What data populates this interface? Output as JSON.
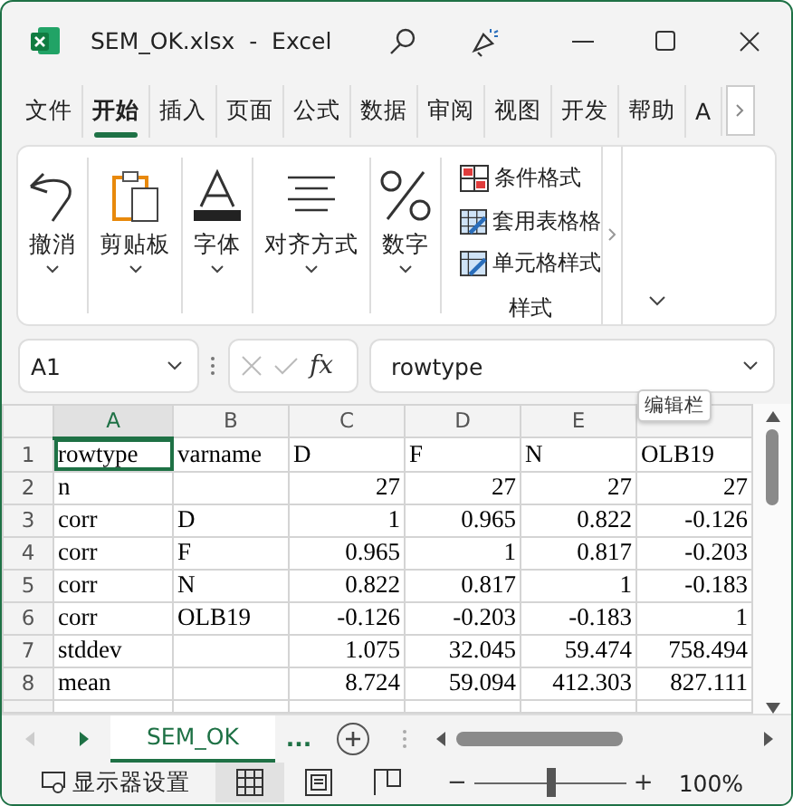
{
  "window": {
    "title": "SEM_OK.xlsx  -  Excel"
  },
  "ribbon_tabs": [
    {
      "label": "文件",
      "selected": false
    },
    {
      "label": "开始",
      "selected": true
    },
    {
      "label": "插入",
      "selected": false
    },
    {
      "label": "页面",
      "selected": false
    },
    {
      "label": "公式",
      "selected": false
    },
    {
      "label": "数据",
      "selected": false
    },
    {
      "label": "审阅",
      "selected": false
    },
    {
      "label": "视图",
      "selected": false
    },
    {
      "label": "开发",
      "selected": false
    },
    {
      "label": "帮助",
      "selected": false
    },
    {
      "label": "A",
      "selected": false
    }
  ],
  "ribbon_groups": [
    {
      "label": "撤消",
      "kind": "undo"
    },
    {
      "label": "剪贴板",
      "kind": "clipboard"
    },
    {
      "label": "字体",
      "kind": "font"
    },
    {
      "label": "对齐方式",
      "kind": "align"
    },
    {
      "label": "数字",
      "kind": "number"
    }
  ],
  "styles_group": {
    "items": [
      {
        "label": "条件格式",
        "kind": "conditional"
      },
      {
        "label": "套用表格格",
        "kind": "table"
      },
      {
        "label": "单元格样式",
        "kind": "cell"
      }
    ],
    "label": "样式"
  },
  "formula_bar": {
    "name_box": "A1",
    "function_symbol": "fx",
    "value": "rowtype",
    "tooltip": "编辑栏"
  },
  "sheet": {
    "columns": [
      "A",
      "B",
      "C",
      "D",
      "E"
    ],
    "rows": [
      {
        "number": "1",
        "cells": [
          "rowtype",
          "varname",
          "D",
          "F",
          "N",
          "OLB19"
        ]
      },
      {
        "number": "2",
        "cells": [
          "n",
          "",
          "27",
          "27",
          "27",
          "27"
        ]
      },
      {
        "number": "3",
        "cells": [
          "corr",
          "D",
          "1",
          "0.965",
          "0.822",
          "-0.126"
        ]
      },
      {
        "number": "4",
        "cells": [
          "corr",
          "F",
          "0.965",
          "1",
          "0.817",
          "-0.203"
        ]
      },
      {
        "number": "5",
        "cells": [
          "corr",
          "N",
          "0.822",
          "0.817",
          "1",
          "-0.183"
        ]
      },
      {
        "number": "6",
        "cells": [
          "corr",
          "OLB19",
          "-0.126",
          "-0.203",
          "-0.183",
          "1"
        ]
      },
      {
        "number": "7",
        "cells": [
          "stddev",
          "",
          "1.075",
          "32.045",
          "59.474",
          "758.494"
        ]
      },
      {
        "number": "8",
        "cells": [
          "mean",
          "",
          "8.724",
          "59.094",
          "412.303",
          "827.111"
        ]
      }
    ]
  },
  "sheet_tabs": [
    {
      "label": "SEM_OK",
      "selected": true
    },
    {
      "label": "...",
      "selected": false
    }
  ],
  "status_bar": {
    "display_settings": "显示器设置",
    "views": [
      {
        "kind": "normal",
        "selected": true
      },
      {
        "kind": "page",
        "selected": false
      },
      {
        "kind": "break",
        "selected": false
      }
    ],
    "zoom": {
      "level": 0.5,
      "minus": "−",
      "plus": "+",
      "reading": "100%"
    }
  }
}
